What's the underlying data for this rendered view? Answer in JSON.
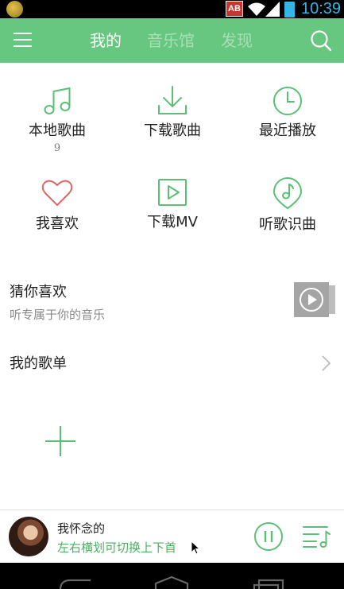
{
  "status_bar": {
    "clock": "10:39",
    "badge": "AB",
    "icons": [
      "app-icon",
      "wifi-icon",
      "signal-icon",
      "battery-icon"
    ],
    "accent_color": "#33b5e5"
  },
  "header": {
    "tabs": [
      {
        "label": "我的",
        "active": true
      },
      {
        "label": "音乐馆",
        "active": false
      },
      {
        "label": "发现",
        "active": false
      }
    ],
    "background_color": "#67c67f",
    "icons": [
      "menu-icon",
      "search-icon"
    ]
  },
  "grid": [
    {
      "label": "本地歌曲",
      "count": "9",
      "icon": "music-note-icon"
    },
    {
      "label": "下载歌曲",
      "icon": "download-icon"
    },
    {
      "label": "最近播放",
      "icon": "clock-icon"
    },
    {
      "label": "我喜欢",
      "icon": "heart-icon"
    },
    {
      "label": "下载MV",
      "icon": "video-play-icon"
    },
    {
      "label": "听歌识曲",
      "icon": "music-recognize-icon"
    }
  ],
  "guess": {
    "title": "猜你喜欢",
    "subtitle": "听专属于你的音乐"
  },
  "playlists": {
    "title": "我的歌单"
  },
  "player": {
    "song_title": "我怀念的",
    "hint": "左右横划可切换上下首"
  },
  "colors": {
    "accent_green": "#67c67f",
    "icon_green": "#5bbf75",
    "heart_red": "#e06666"
  }
}
